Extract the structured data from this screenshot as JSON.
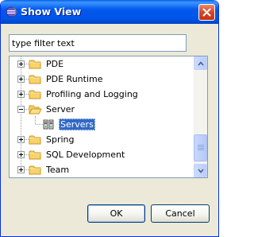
{
  "window": {
    "title": "Show View"
  },
  "filter": {
    "placeholder": "type filter text",
    "value": "type filter text"
  },
  "tree": {
    "items": [
      {
        "label": "PDE",
        "icon": "folder-icon",
        "expanded": false,
        "selected": false,
        "level": 0
      },
      {
        "label": "PDE Runtime",
        "icon": "folder-icon",
        "expanded": false,
        "selected": false,
        "level": 0
      },
      {
        "label": "Profiling and Logging",
        "icon": "folder-icon",
        "expanded": false,
        "selected": false,
        "level": 0
      },
      {
        "label": "Server",
        "icon": "folder-open-icon",
        "expanded": true,
        "selected": false,
        "level": 0
      },
      {
        "label": "Servers",
        "icon": "servers-view-icon",
        "expanded": null,
        "selected": true,
        "level": 1
      },
      {
        "label": "Spring",
        "icon": "folder-icon",
        "expanded": false,
        "selected": false,
        "level": 0
      },
      {
        "label": "SQL Development",
        "icon": "folder-icon",
        "expanded": false,
        "selected": false,
        "level": 0
      },
      {
        "label": "Team",
        "icon": "folder-icon",
        "expanded": false,
        "selected": false,
        "level": 0
      }
    ]
  },
  "buttons": {
    "ok": "OK",
    "cancel": "Cancel"
  },
  "colors": {
    "titlebar": "#0058ee",
    "selection": "#316ac5",
    "dialog": "#ece9d8",
    "folder": "#f5c542",
    "border": "#7f9db9"
  }
}
